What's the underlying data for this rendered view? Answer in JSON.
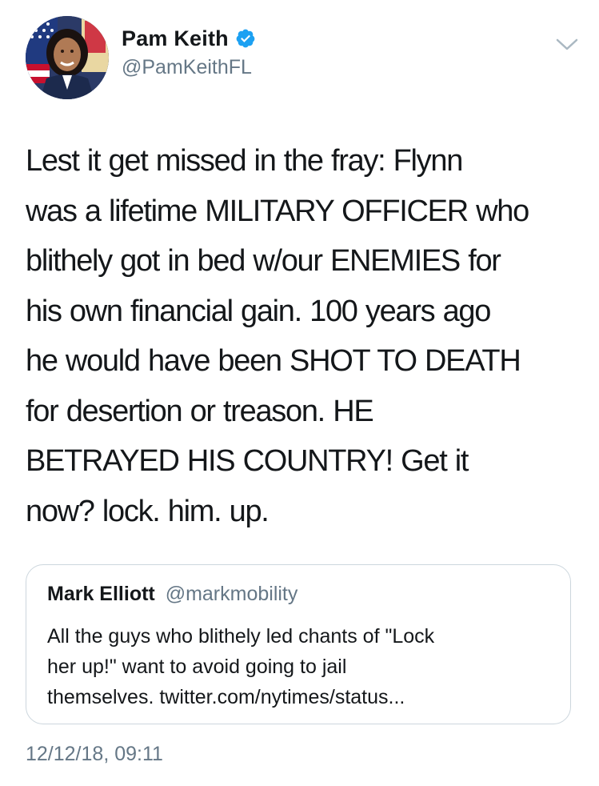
{
  "tweet": {
    "author": {
      "display_name": "Pam Keith",
      "handle": "@PamKeithFL",
      "verified": true,
      "verified_color": "#1da1f2"
    },
    "text_lines": [
      "Lest it get missed in the fray: Flynn",
      "was a lifetime MILITARY OFFICER who",
      "blithely got in bed w/our ENEMIES for",
      "his own financial gain. 100 years ago",
      "he would have been SHOT TO DEATH",
      "for desertion or treason.  HE",
      "BETRAYED HIS COUNTRY! Get it",
      "now? lock. him. up."
    ],
    "quoted_tweet": {
      "display_name": "Mark Elliott",
      "handle": "@markmobility",
      "text_lines": [
        "All the guys who blithely led chants of \"Lock",
        "her up!\" want to avoid going to jail",
        "themselves. twitter.com/nytimes/status..."
      ]
    },
    "timestamp": "12/12/18, 09:11"
  },
  "icons": {
    "verified": "verified-badge-icon",
    "menu": "chevron-down-icon",
    "avatar": "profile-photo"
  },
  "colors": {
    "text": "#14171a",
    "secondary_text": "#657786",
    "border": "#ccd6dd",
    "accent": "#1da1f2"
  }
}
